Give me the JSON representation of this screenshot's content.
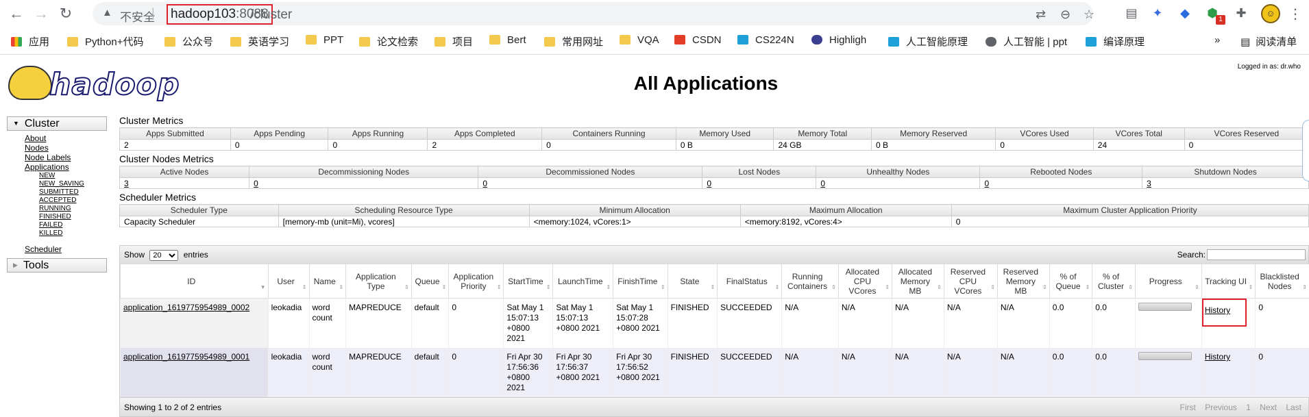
{
  "browser": {
    "insecure_label": "不安全",
    "url_host": "hadoop103",
    "url_port": ":8088",
    "url_path": "/cluster",
    "badge_count": "1",
    "bookmarks": [
      "应用",
      "Python+代码",
      "公众号",
      "英语学习",
      "PPT",
      "论文检索",
      "项目",
      "Bert",
      "常用网址",
      "VQA",
      "CSDN",
      "CS224N",
      "Highligh",
      "人工智能原理",
      "人工智能 | ppt",
      "编译原理"
    ],
    "more": "»",
    "reading_list": "阅读清单"
  },
  "page": {
    "logo_text": "hadoop",
    "title": "All Applications",
    "logged_in": "Logged in as: dr.who"
  },
  "nav": {
    "cluster": "Cluster",
    "links": [
      "About",
      "Nodes",
      "Node Labels",
      "Applications"
    ],
    "states": [
      "NEW",
      "NEW_SAVING",
      "SUBMITTED",
      "ACCEPTED",
      "RUNNING",
      "FINISHED",
      "FAILED",
      "KILLED"
    ],
    "scheduler": "Scheduler",
    "tools": "Tools"
  },
  "cluster_metrics": {
    "title": "Cluster Metrics",
    "headers": [
      "Apps Submitted",
      "Apps Pending",
      "Apps Running",
      "Apps Completed",
      "Containers Running",
      "Memory Used",
      "Memory Total",
      "Memory Reserved",
      "VCores Used",
      "VCores Total",
      "VCores Reserved"
    ],
    "values": [
      "2",
      "0",
      "0",
      "2",
      "0",
      "0 B",
      "24 GB",
      "0 B",
      "0",
      "24",
      "0"
    ]
  },
  "node_metrics": {
    "title": "Cluster Nodes Metrics",
    "headers": [
      "Active Nodes",
      "Decommissioning Nodes",
      "Decommissioned Nodes",
      "Lost Nodes",
      "Unhealthy Nodes",
      "Rebooted Nodes",
      "Shutdown Nodes"
    ],
    "values": [
      "3",
      "0",
      "0",
      "0",
      "0",
      "0",
      "3"
    ]
  },
  "scheduler_metrics": {
    "title": "Scheduler Metrics",
    "headers": [
      "Scheduler Type",
      "Scheduling Resource Type",
      "Minimum Allocation",
      "Maximum Allocation",
      "Maximum Cluster Application Priority"
    ],
    "values": [
      "Capacity Scheduler",
      "[memory-mb (unit=Mi), vcores]",
      "<memory:1024, vCores:1>",
      "<memory:8192, vCores:4>",
      "0"
    ]
  },
  "apps": {
    "show_label": "Show",
    "entries_value": "20",
    "entries_label": "entries",
    "search_label": "Search:",
    "headers": [
      "ID",
      "User",
      "Name",
      "Application Type",
      "Queue",
      "Application Priority",
      "StartTime",
      "LaunchTime",
      "FinishTime",
      "State",
      "FinalStatus",
      "Running Containers",
      "Allocated CPU VCores",
      "Allocated Memory MB",
      "Reserved CPU VCores",
      "Reserved Memory MB",
      "% of Queue",
      "% of Cluster",
      "Progress",
      "Tracking UI",
      "Blacklisted Nodes"
    ],
    "rows": [
      {
        "id": "application_1619775954989_0002",
        "user": "leokadia",
        "name": "word count",
        "type": "MAPREDUCE",
        "queue": "default",
        "priority": "0",
        "start": "Sat May 1 15:07:13 +0800 2021",
        "launch": "Sat May 1 15:07:13 +0800 2021",
        "finish": "Sat May 1 15:07:28 +0800 2021",
        "state": "FINISHED",
        "final": "SUCCEEDED",
        "containers": "N/A",
        "acpu": "N/A",
        "amem": "N/A",
        "rcpu": "N/A",
        "rmem": "N/A",
        "pq": "0.0",
        "pc": "0.0",
        "progress": 1.0,
        "tracking": "History",
        "blacklisted": "0"
      },
      {
        "id": "application_1619775954989_0001",
        "user": "leokadia",
        "name": "word count",
        "type": "MAPREDUCE",
        "queue": "default",
        "priority": "0",
        "start": "Fri Apr 30 17:56:36 +0800 2021",
        "launch": "Fri Apr 30 17:56:37 +0800 2021",
        "finish": "Fri Apr 30 17:56:52 +0800 2021",
        "state": "FINISHED",
        "final": "SUCCEEDED",
        "containers": "N/A",
        "acpu": "N/A",
        "amem": "N/A",
        "rcpu": "N/A",
        "rmem": "N/A",
        "pq": "0.0",
        "pc": "0.0",
        "progress": 1.0,
        "tracking": "History",
        "blacklisted": "0"
      }
    ],
    "footer": "Showing 1 to 2 of 2 entries",
    "pager": [
      "First",
      "Previous",
      "1",
      "Next",
      "Last"
    ]
  },
  "colors": {
    "highlight_box": "#e0202a",
    "row_alt": "#eeeef8"
  }
}
